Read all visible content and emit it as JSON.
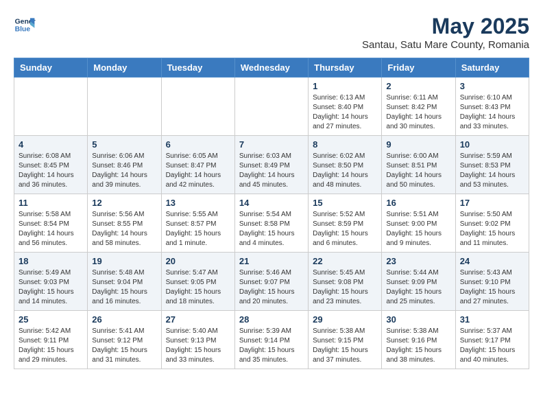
{
  "header": {
    "logo_line1": "General",
    "logo_line2": "Blue",
    "month_year": "May 2025",
    "location": "Santau, Satu Mare County, Romania"
  },
  "days_of_week": [
    "Sunday",
    "Monday",
    "Tuesday",
    "Wednesday",
    "Thursday",
    "Friday",
    "Saturday"
  ],
  "weeks": [
    [
      {
        "day": "",
        "content": ""
      },
      {
        "day": "",
        "content": ""
      },
      {
        "day": "",
        "content": ""
      },
      {
        "day": "",
        "content": ""
      },
      {
        "day": "1",
        "content": "Sunrise: 6:13 AM\nSunset: 8:40 PM\nDaylight: 14 hours\nand 27 minutes."
      },
      {
        "day": "2",
        "content": "Sunrise: 6:11 AM\nSunset: 8:42 PM\nDaylight: 14 hours\nand 30 minutes."
      },
      {
        "day": "3",
        "content": "Sunrise: 6:10 AM\nSunset: 8:43 PM\nDaylight: 14 hours\nand 33 minutes."
      }
    ],
    [
      {
        "day": "4",
        "content": "Sunrise: 6:08 AM\nSunset: 8:45 PM\nDaylight: 14 hours\nand 36 minutes."
      },
      {
        "day": "5",
        "content": "Sunrise: 6:06 AM\nSunset: 8:46 PM\nDaylight: 14 hours\nand 39 minutes."
      },
      {
        "day": "6",
        "content": "Sunrise: 6:05 AM\nSunset: 8:47 PM\nDaylight: 14 hours\nand 42 minutes."
      },
      {
        "day": "7",
        "content": "Sunrise: 6:03 AM\nSunset: 8:49 PM\nDaylight: 14 hours\nand 45 minutes."
      },
      {
        "day": "8",
        "content": "Sunrise: 6:02 AM\nSunset: 8:50 PM\nDaylight: 14 hours\nand 48 minutes."
      },
      {
        "day": "9",
        "content": "Sunrise: 6:00 AM\nSunset: 8:51 PM\nDaylight: 14 hours\nand 50 minutes."
      },
      {
        "day": "10",
        "content": "Sunrise: 5:59 AM\nSunset: 8:53 PM\nDaylight: 14 hours\nand 53 minutes."
      }
    ],
    [
      {
        "day": "11",
        "content": "Sunrise: 5:58 AM\nSunset: 8:54 PM\nDaylight: 14 hours\nand 56 minutes."
      },
      {
        "day": "12",
        "content": "Sunrise: 5:56 AM\nSunset: 8:55 PM\nDaylight: 14 hours\nand 58 minutes."
      },
      {
        "day": "13",
        "content": "Sunrise: 5:55 AM\nSunset: 8:57 PM\nDaylight: 15 hours\nand 1 minute."
      },
      {
        "day": "14",
        "content": "Sunrise: 5:54 AM\nSunset: 8:58 PM\nDaylight: 15 hours\nand 4 minutes."
      },
      {
        "day": "15",
        "content": "Sunrise: 5:52 AM\nSunset: 8:59 PM\nDaylight: 15 hours\nand 6 minutes."
      },
      {
        "day": "16",
        "content": "Sunrise: 5:51 AM\nSunset: 9:00 PM\nDaylight: 15 hours\nand 9 minutes."
      },
      {
        "day": "17",
        "content": "Sunrise: 5:50 AM\nSunset: 9:02 PM\nDaylight: 15 hours\nand 11 minutes."
      }
    ],
    [
      {
        "day": "18",
        "content": "Sunrise: 5:49 AM\nSunset: 9:03 PM\nDaylight: 15 hours\nand 14 minutes."
      },
      {
        "day": "19",
        "content": "Sunrise: 5:48 AM\nSunset: 9:04 PM\nDaylight: 15 hours\nand 16 minutes."
      },
      {
        "day": "20",
        "content": "Sunrise: 5:47 AM\nSunset: 9:05 PM\nDaylight: 15 hours\nand 18 minutes."
      },
      {
        "day": "21",
        "content": "Sunrise: 5:46 AM\nSunset: 9:07 PM\nDaylight: 15 hours\nand 20 minutes."
      },
      {
        "day": "22",
        "content": "Sunrise: 5:45 AM\nSunset: 9:08 PM\nDaylight: 15 hours\nand 23 minutes."
      },
      {
        "day": "23",
        "content": "Sunrise: 5:44 AM\nSunset: 9:09 PM\nDaylight: 15 hours\nand 25 minutes."
      },
      {
        "day": "24",
        "content": "Sunrise: 5:43 AM\nSunset: 9:10 PM\nDaylight: 15 hours\nand 27 minutes."
      }
    ],
    [
      {
        "day": "25",
        "content": "Sunrise: 5:42 AM\nSunset: 9:11 PM\nDaylight: 15 hours\nand 29 minutes."
      },
      {
        "day": "26",
        "content": "Sunrise: 5:41 AM\nSunset: 9:12 PM\nDaylight: 15 hours\nand 31 minutes."
      },
      {
        "day": "27",
        "content": "Sunrise: 5:40 AM\nSunset: 9:13 PM\nDaylight: 15 hours\nand 33 minutes."
      },
      {
        "day": "28",
        "content": "Sunrise: 5:39 AM\nSunset: 9:14 PM\nDaylight: 15 hours\nand 35 minutes."
      },
      {
        "day": "29",
        "content": "Sunrise: 5:38 AM\nSunset: 9:15 PM\nDaylight: 15 hours\nand 37 minutes."
      },
      {
        "day": "30",
        "content": "Sunrise: 5:38 AM\nSunset: 9:16 PM\nDaylight: 15 hours\nand 38 minutes."
      },
      {
        "day": "31",
        "content": "Sunrise: 5:37 AM\nSunset: 9:17 PM\nDaylight: 15 hours\nand 40 minutes."
      }
    ]
  ]
}
